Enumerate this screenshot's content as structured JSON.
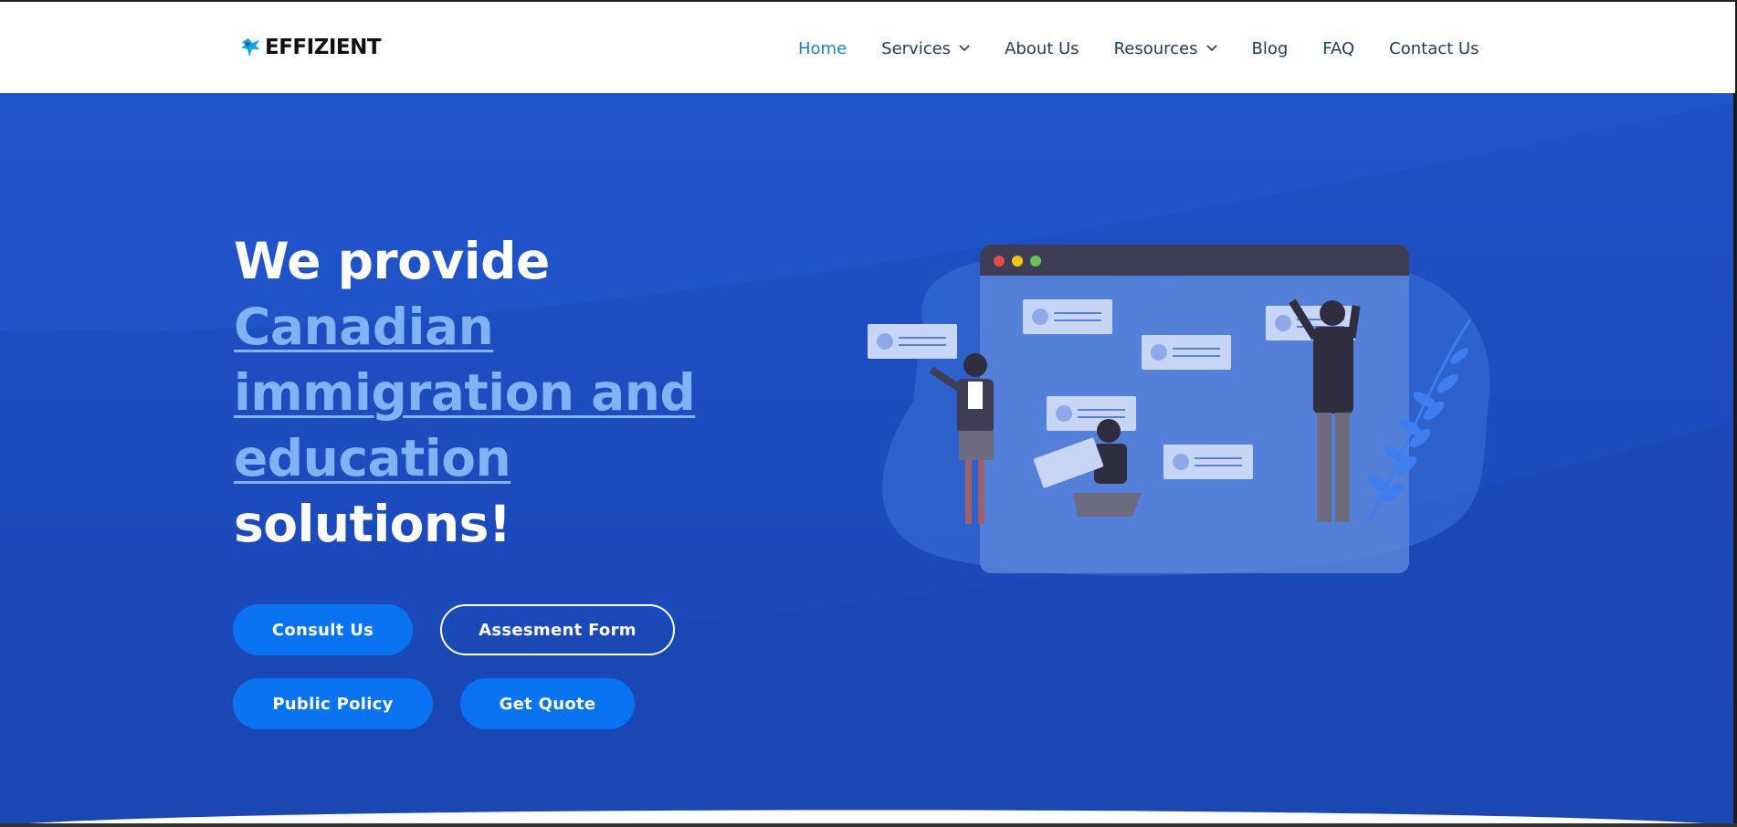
{
  "brand": {
    "name": "EFFIZIENT",
    "logo_icon": "bird-logo-icon"
  },
  "nav": {
    "items": [
      {
        "label": "Home",
        "active": true,
        "dropdown": false
      },
      {
        "label": "Services",
        "active": false,
        "dropdown": true
      },
      {
        "label": "About Us",
        "active": false,
        "dropdown": false
      },
      {
        "label": "Resources",
        "active": false,
        "dropdown": true
      },
      {
        "label": "Blog",
        "active": false,
        "dropdown": false
      },
      {
        "label": "FAQ",
        "active": false,
        "dropdown": false
      },
      {
        "label": "Contact Us",
        "active": false,
        "dropdown": false
      }
    ]
  },
  "hero": {
    "line1": "We provide",
    "highlight_line1": "Canadian",
    "highlight_line2": "immigration and",
    "highlight_line3": "education",
    "line_end": "solutions!",
    "buttons": {
      "consult": "Consult Us",
      "assessment": "Assesment Form",
      "policy": "Public Policy",
      "quote": "Get Quote"
    }
  },
  "colors": {
    "hero_bg": "#1f51c6",
    "highlight": "#7fb3f5",
    "button": "#0a73f2",
    "nav_active": "#1a7fd1",
    "nav_text": "#1f3a5f"
  }
}
